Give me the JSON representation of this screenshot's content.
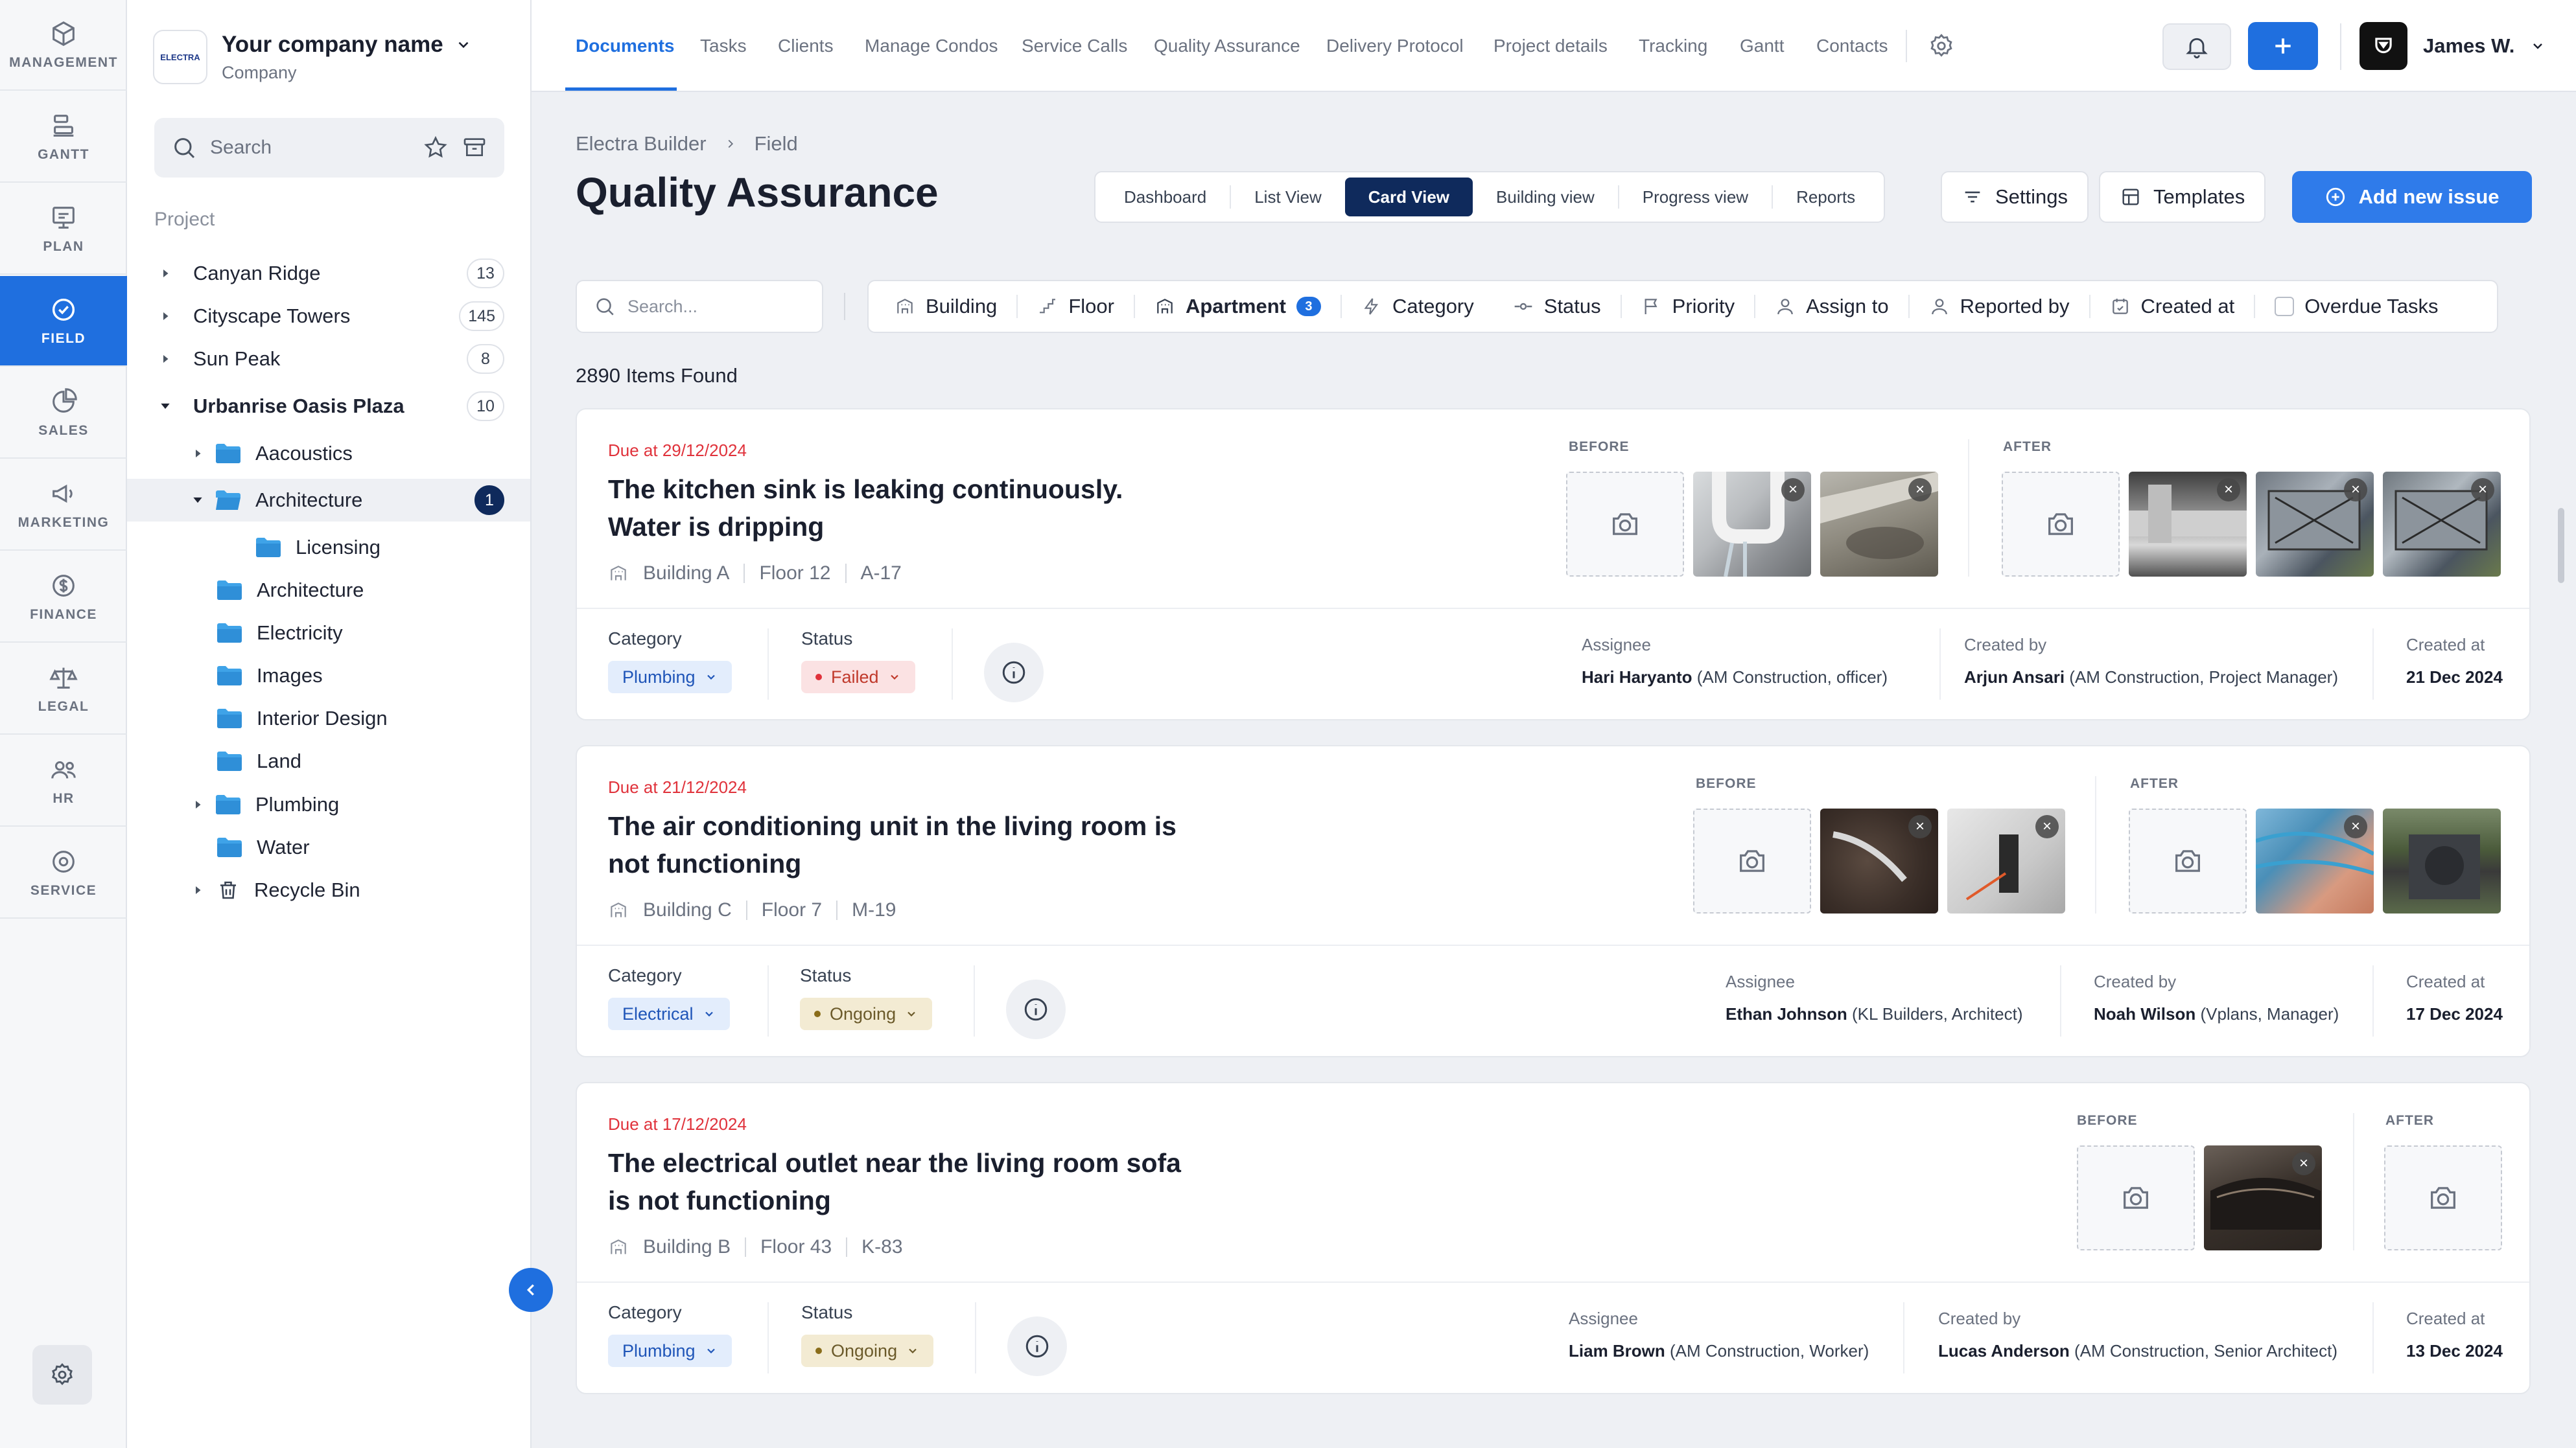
{
  "rail": {
    "items": [
      {
        "label": "MANAGEMENT",
        "icon": "cube-icon"
      },
      {
        "label": "GANTT",
        "icon": "gantt-icon"
      },
      {
        "label": "PLAN",
        "icon": "plan-icon"
      },
      {
        "label": "FIELD",
        "icon": "check-circle-icon"
      },
      {
        "label": "SALES",
        "icon": "pie-chart-icon"
      },
      {
        "label": "MARKETING",
        "icon": "megaphone-icon"
      },
      {
        "label": "FINANCE",
        "icon": "dollar-icon"
      },
      {
        "label": "LEGAL",
        "icon": "scales-icon"
      },
      {
        "label": "HR",
        "icon": "people-icon"
      },
      {
        "label": "SERVICE",
        "icon": "service-icon"
      }
    ],
    "active": "FIELD"
  },
  "sidebar": {
    "company_name": "Your company name",
    "company_sub": "Company",
    "logo_text": "ELECTRA",
    "search_placeholder": "Search",
    "project_label": "Project",
    "projects": [
      {
        "name": "Canyan Ridge",
        "count": "13"
      },
      {
        "name": "Cityscape Towers",
        "count": "145"
      },
      {
        "name": "Sun Peak",
        "count": "8"
      },
      {
        "name": "Urbanrise Oasis Plaza",
        "count": "10"
      }
    ],
    "folders": [
      {
        "name": "Aacoustics"
      },
      {
        "name": "Architecture",
        "count": "1"
      },
      {
        "name": "Licensing"
      },
      {
        "name": "Architecture"
      },
      {
        "name": "Electricity"
      },
      {
        "name": "Images"
      },
      {
        "name": "Interior Design"
      },
      {
        "name": "Land"
      },
      {
        "name": "Plumbing"
      },
      {
        "name": "Water"
      },
      {
        "name": "Recycle Bin"
      }
    ]
  },
  "topnav": {
    "tabs": [
      "Documents",
      "Tasks",
      "Clients",
      "Manage Condos",
      "Service Calls",
      "Quality Assurance",
      "Delivery Protocol",
      "Project details",
      "Tracking",
      "Gantt",
      "Contacts"
    ],
    "active_tab": "Documents",
    "user_name": "James W."
  },
  "header": {
    "breadcrumb": [
      "Electra Builder",
      "Field"
    ],
    "title": "Quality Assurance",
    "views": [
      "Dashboard",
      "List View",
      "Card View",
      "Building view",
      "Progress view",
      "Reports"
    ],
    "active_view": "Card View",
    "settings_label": "Settings",
    "templates_label": "Templates",
    "add_label": "Add new issue"
  },
  "filters": {
    "search_placeholder": "Search...",
    "items": [
      "Building",
      "Floor",
      "Apartment",
      "Category",
      "Status",
      "Priority",
      "Assign to",
      "Reported by",
      "Created at",
      "Overdue Tasks"
    ],
    "apartment_badge": "3"
  },
  "items_found": "2890 Items Found",
  "cards": [
    {
      "due": "Due at 29/12/2024",
      "title_line1": "The kitchen sink is leaking continuously.",
      "title_line2": "Water is dripping",
      "building": "Building A",
      "floor": "Floor 12",
      "unit": "A-17",
      "category_label": "Category",
      "category": "Plumbing",
      "status_label": "Status",
      "status": "Failed",
      "assignee_label": "Assignee",
      "assignee_name": "Hari Haryanto",
      "assignee_role": " (AM Construction, officer)",
      "created_by_label": "Created by",
      "created_by_name": "Arjun Ansari",
      "created_by_role": " (AM Construction, Project Manager)",
      "created_at_label": "Created at",
      "created_at": "21 Dec 2024",
      "before_label": "BEFORE",
      "after_label": "AFTER"
    },
    {
      "due": "Due at 21/12/2024",
      "title_line1": "The air conditioning unit in the living room is",
      "title_line2": "not functioning",
      "building": "Building C",
      "floor": "Floor 7",
      "unit": "M-19",
      "category_label": "Category",
      "category": "Electrical",
      "status_label": "Status",
      "status": "Ongoing",
      "assignee_label": "Assignee",
      "assignee_name": "Ethan Johnson",
      "assignee_role": " (KL Builders, Architect)",
      "created_by_label": "Created by",
      "created_by_name": "Noah Wilson",
      "created_by_role": " (Vplans,  Manager)",
      "created_at_label": "Created at",
      "created_at": "17 Dec 2024",
      "before_label": "BEFORE",
      "after_label": "AFTER"
    },
    {
      "due": "Due at 17/12/2024",
      "title_line1": "The electrical outlet near the living room sofa",
      "title_line2": "is not functioning",
      "building": "Building B",
      "floor": "Floor 43",
      "unit": "K-83",
      "category_label": "Category",
      "category": "Plumbing",
      "status_label": "Status",
      "status": "Ongoing",
      "assignee_label": "Assignee",
      "assignee_name": "Liam Brown",
      "assignee_role": " (AM Construction, Worker)",
      "created_by_label": "Created by",
      "created_by_name": "Lucas Anderson",
      "created_by_role": " (AM Construction, Senior Architect)",
      "created_at_label": "Created at",
      "created_at": "13 Dec 2024",
      "before_label": "BEFORE",
      "after_label": "AFTER"
    }
  ],
  "colors": {
    "accent": "#1f6fdf",
    "navy": "#0f2a5c",
    "danger": "#e0323b"
  }
}
